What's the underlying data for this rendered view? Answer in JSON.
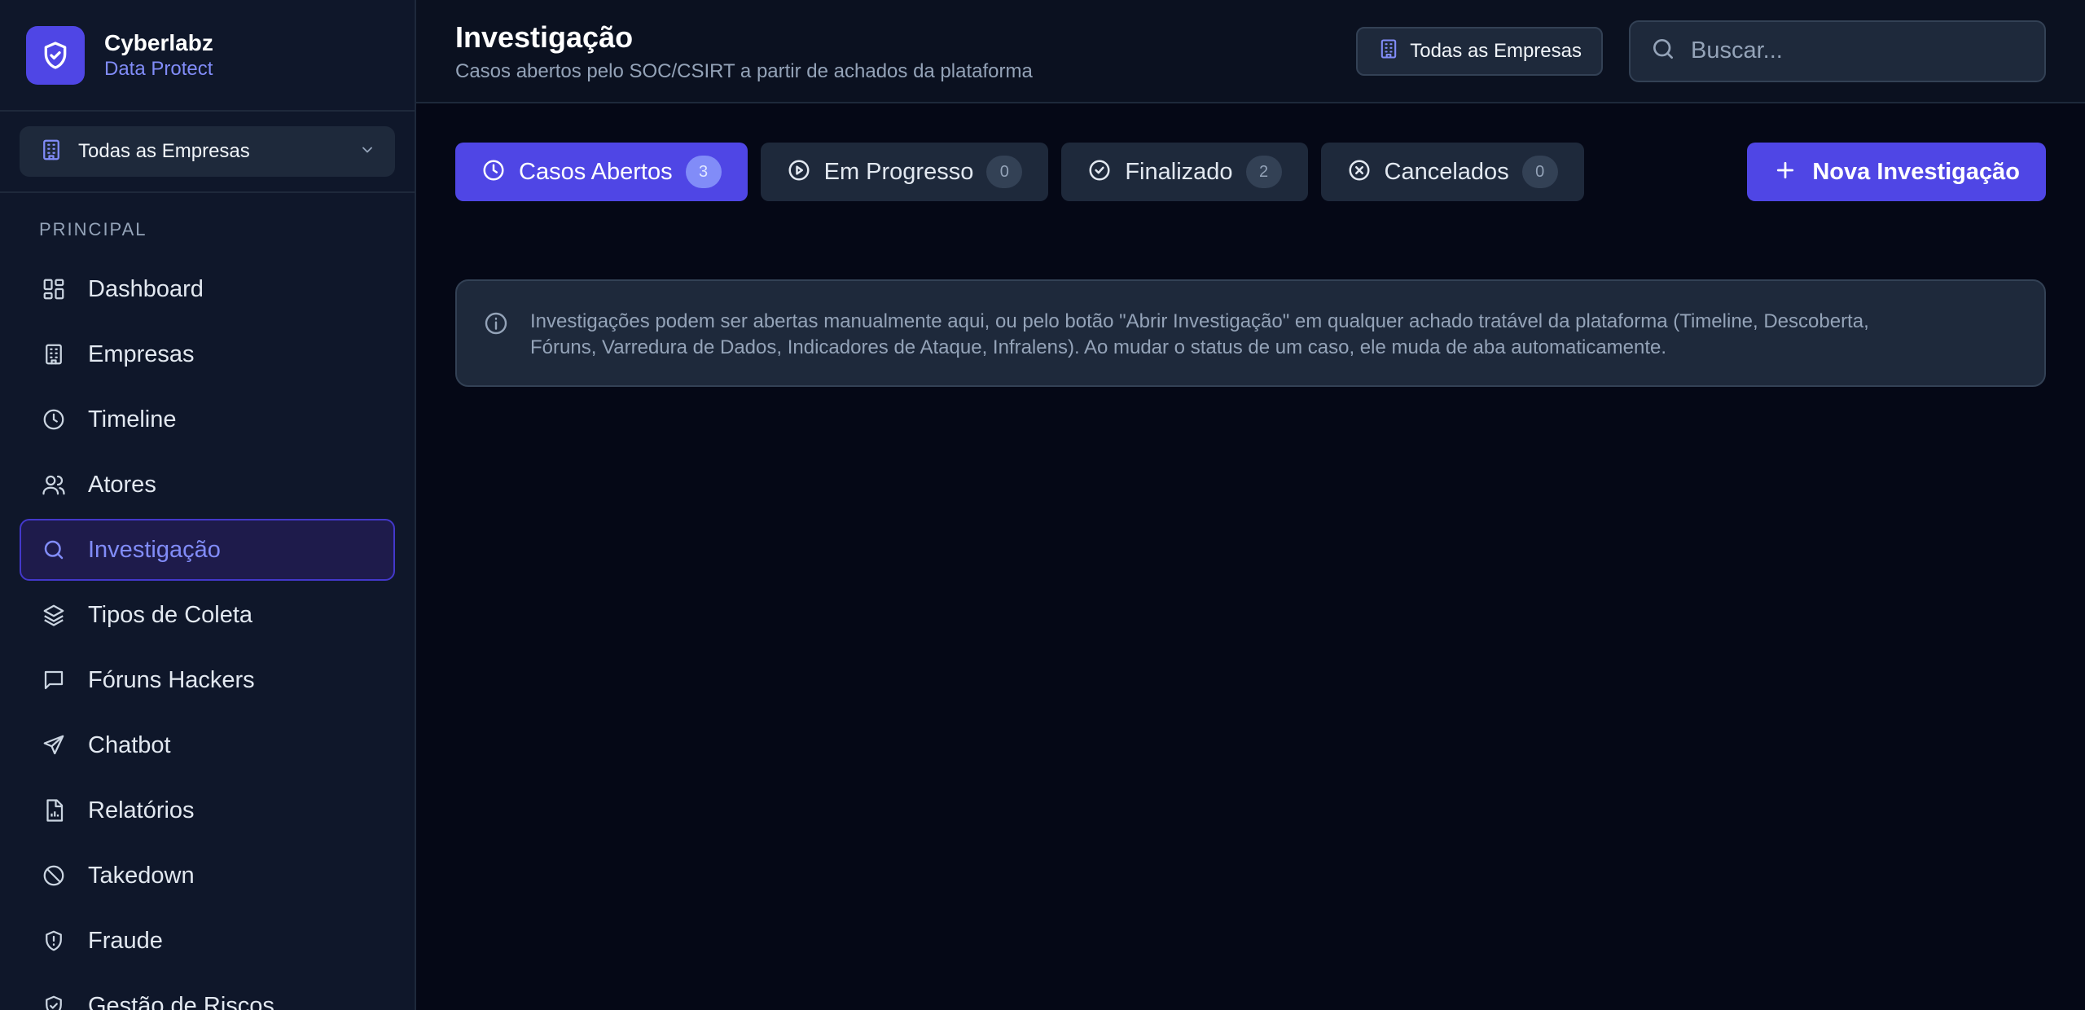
{
  "brand": {
    "name": "Cyberlabz",
    "subtitle": "Data Protect"
  },
  "sidebar": {
    "company_selector": "Todas as Empresas",
    "section_label": "PRINCIPAL",
    "items": [
      {
        "label": "Dashboard",
        "icon": "dashboard-icon"
      },
      {
        "label": "Empresas",
        "icon": "building-icon"
      },
      {
        "label": "Timeline",
        "icon": "clock-icon"
      },
      {
        "label": "Atores",
        "icon": "users-icon"
      },
      {
        "label": "Investigação",
        "icon": "search-icon",
        "active": true
      },
      {
        "label": "Tipos de Coleta",
        "icon": "layers-icon"
      },
      {
        "label": "Fóruns Hackers",
        "icon": "message-square-icon"
      },
      {
        "label": "Chatbot",
        "icon": "send-icon"
      },
      {
        "label": "Relatórios",
        "icon": "file-chart-icon"
      },
      {
        "label": "Takedown",
        "icon": "ban-icon"
      },
      {
        "label": "Fraude",
        "icon": "shield-alert-icon"
      },
      {
        "label": "Gestão de Riscos",
        "icon": "shield-check-icon"
      }
    ]
  },
  "header": {
    "title": "Investigação",
    "subtitle": "Casos abertos pelo SOC/CSIRT a partir de achados da plataforma",
    "company_button": "Todas as Empresas",
    "search_placeholder": "Buscar..."
  },
  "tabs": [
    {
      "label": "Casos Abertos",
      "count": "3",
      "icon": "clock-icon",
      "active": true
    },
    {
      "label": "Em Progresso",
      "count": "0",
      "icon": "play-circle-icon"
    },
    {
      "label": "Finalizado",
      "count": "2",
      "icon": "check-circle-icon"
    },
    {
      "label": "Cancelados",
      "count": "0",
      "icon": "x-circle-icon"
    }
  ],
  "new_button": "Nova Investigação",
  "info": {
    "line1": "Investigações podem ser abertas manualmente aqui, ou pelo botão \"Abrir Investigação\" em qualquer achado tratável da plataforma (Timeline, Descoberta,",
    "line2": "Fóruns, Varredura de Dados, Indicadores de Ataque, Infralens). Ao mudar o status de um caso, ele muda de aba automaticamente."
  },
  "colors": {
    "accent": "#4f46e5",
    "accent_light": "#818cf8",
    "background": "#050816",
    "sidebar": "#0f172a",
    "panel": "#1e293b"
  }
}
